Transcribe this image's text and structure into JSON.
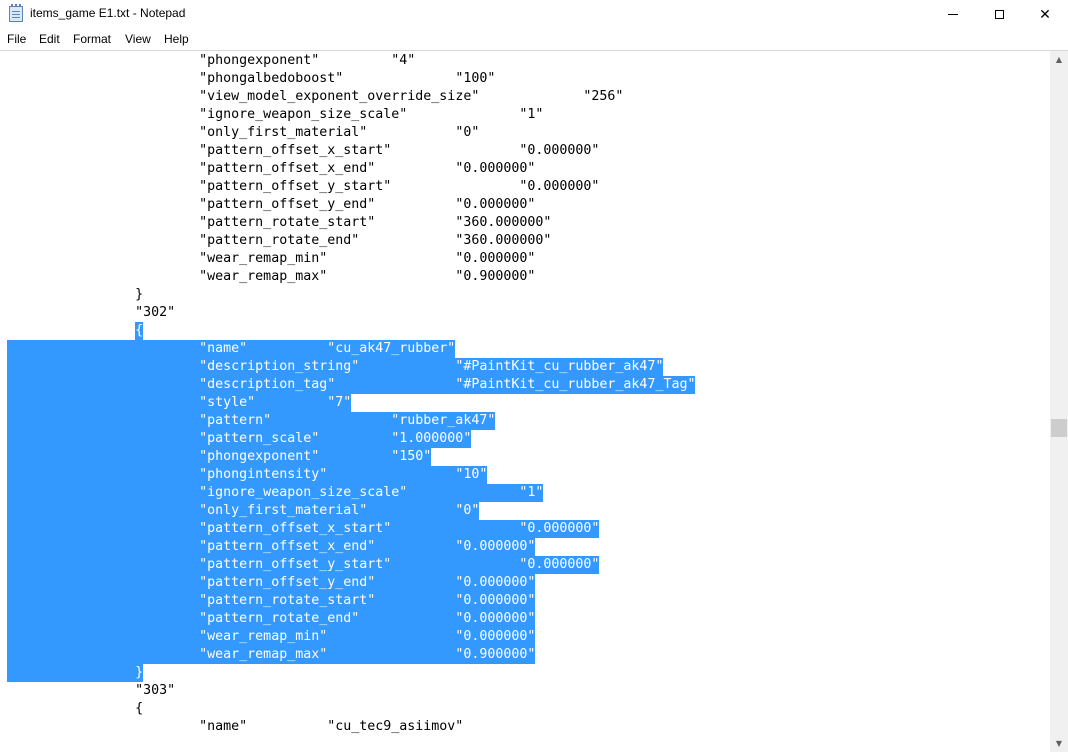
{
  "window": {
    "title": "items_game E1.txt - Notepad",
    "app_icon": "notepad-icon",
    "controls": {
      "minimize": "minimize-icon",
      "maximize": "maximize-icon",
      "close": "close-icon",
      "close_glyph": "✕"
    }
  },
  "menu": [
    "File",
    "Edit",
    "Format",
    "View",
    "Help"
  ],
  "colors": {
    "selection": "#3399ff",
    "selection_text": "#ffffff",
    "text": "#000000",
    "scrollbar": "#f0f0f0",
    "scroll_thumb": "#cdcdcd"
  },
  "scrollbar": {
    "up_glyph": "▲",
    "down_glyph": "▼",
    "position_fraction": 0.55
  },
  "editor": {
    "lines": [
      {
        "text": "\t\t\t\"phongexponent\"\t\t\"4\"",
        "selected": false
      },
      {
        "text": "\t\t\t\"phongalbedoboost\"\t\t\"100\"",
        "selected": false
      },
      {
        "text": "\t\t\t\"view_model_exponent_override_size\"\t\t\"256\"",
        "selected": false
      },
      {
        "text": "\t\t\t\"ignore_weapon_size_scale\"\t\t\"1\"",
        "selected": false
      },
      {
        "text": "\t\t\t\"only_first_material\"\t\t\"0\"",
        "selected": false
      },
      {
        "text": "\t\t\t\"pattern_offset_x_start\"\t\t\"0.000000\"",
        "selected": false
      },
      {
        "text": "\t\t\t\"pattern_offset_x_end\"\t\t\"0.000000\"",
        "selected": false
      },
      {
        "text": "\t\t\t\"pattern_offset_y_start\"\t\t\"0.000000\"",
        "selected": false
      },
      {
        "text": "\t\t\t\"pattern_offset_y_end\"\t\t\"0.000000\"",
        "selected": false
      },
      {
        "text": "\t\t\t\"pattern_rotate_start\"\t\t\"360.000000\"",
        "selected": false
      },
      {
        "text": "\t\t\t\"pattern_rotate_end\"\t\t\"360.000000\"",
        "selected": false
      },
      {
        "text": "\t\t\t\"wear_remap_min\"\t\t\"0.000000\"",
        "selected": false
      },
      {
        "text": "\t\t\t\"wear_remap_max\"\t\t\"0.900000\"",
        "selected": false
      },
      {
        "text": "\t\t}",
        "selected": false
      },
      {
        "text": "\t\t\"302\"",
        "selected": false
      },
      {
        "text": "\t\t{",
        "selected": true
      },
      {
        "text": "\t\t\t\"name\"\t\t\"cu_ak47_rubber\"",
        "selected": true
      },
      {
        "text": "\t\t\t\"description_string\"\t\t\"#PaintKit_cu_rubber_ak47\"",
        "selected": true
      },
      {
        "text": "\t\t\t\"description_tag\"\t\t\"#PaintKit_cu_rubber_ak47_Tag\"",
        "selected": true
      },
      {
        "text": "\t\t\t\"style\"\t\t\"7\"",
        "selected": true
      },
      {
        "text": "\t\t\t\"pattern\"\t\t\"rubber_ak47\"",
        "selected": true
      },
      {
        "text": "\t\t\t\"pattern_scale\"\t\t\"1.000000\"",
        "selected": true
      },
      {
        "text": "\t\t\t\"phongexponent\"\t\t\"150\"",
        "selected": true
      },
      {
        "text": "\t\t\t\"phongintensity\"\t\t\"10\"",
        "selected": true
      },
      {
        "text": "\t\t\t\"ignore_weapon_size_scale\"\t\t\"1\"",
        "selected": true
      },
      {
        "text": "\t\t\t\"only_first_material\"\t\t\"0\"",
        "selected": true
      },
      {
        "text": "\t\t\t\"pattern_offset_x_start\"\t\t\"0.000000\"",
        "selected": true
      },
      {
        "text": "\t\t\t\"pattern_offset_x_end\"\t\t\"0.000000\"",
        "selected": true
      },
      {
        "text": "\t\t\t\"pattern_offset_y_start\"\t\t\"0.000000\"",
        "selected": true
      },
      {
        "text": "\t\t\t\"pattern_offset_y_end\"\t\t\"0.000000\"",
        "selected": true
      },
      {
        "text": "\t\t\t\"pattern_rotate_start\"\t\t\"0.000000\"",
        "selected": true
      },
      {
        "text": "\t\t\t\"pattern_rotate_end\"\t\t\"0.000000\"",
        "selected": true
      },
      {
        "text": "\t\t\t\"wear_remap_min\"\t\t\"0.000000\"",
        "selected": true
      },
      {
        "text": "\t\t\t\"wear_remap_max\"\t\t\"0.900000\"",
        "selected": true
      },
      {
        "text": "\t\t}",
        "selected": true
      },
      {
        "text": "\t\t\"303\"",
        "selected": false
      },
      {
        "text": "\t\t{",
        "selected": false
      },
      {
        "text": "\t\t\t\"name\"\t\t\"cu_tec9_asiimov\"",
        "selected": false
      }
    ]
  }
}
